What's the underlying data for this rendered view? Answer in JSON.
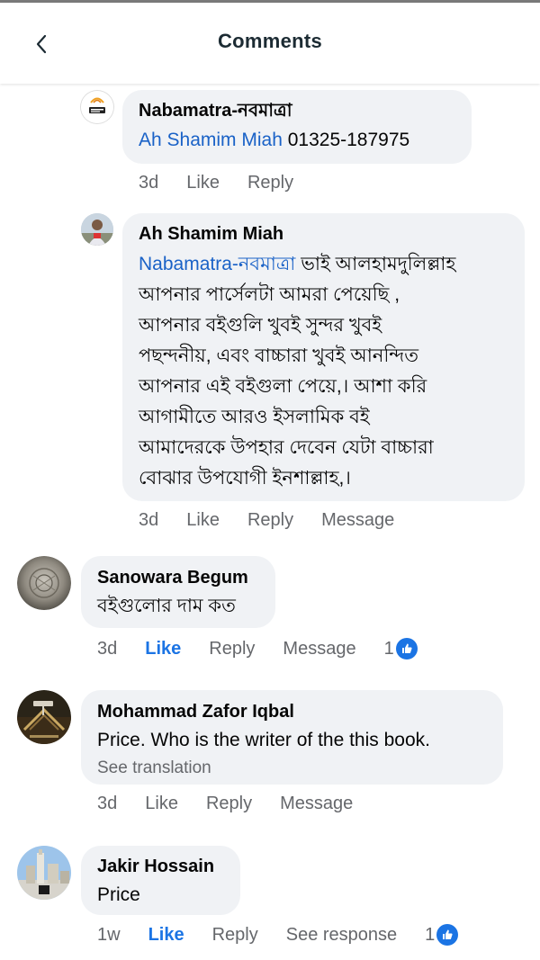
{
  "header": {
    "title": "Comments",
    "back_icon": "chevron-left-icon"
  },
  "colors": {
    "mention": "#1a62c7",
    "like_active": "#1b74e4",
    "bubble_bg": "#f0f2f5",
    "meta_text": "#65676b"
  },
  "comments": [
    {
      "name": "Nabamatra-নবমাত্রা",
      "mention": "Ah Shamim Miah",
      "text": " 01325-187975",
      "time": "3d",
      "like": "Like",
      "reply": "Reply"
    },
    {
      "name": "Ah Shamim Miah",
      "mention": "Nabamatra-নবমাত্রা",
      "lines": [
        " ভাই আলহামদুলিল্লাহ",
        "আপনার পার্সেলটা আমরা পেয়েছি ,",
        "আপনার বইগুলি খুবই সুন্দর খুবই",
        "পছন্দনীয়, এবং বাচ্চারা খুবই আনন্দিত",
        "আপনার এই বইগুলা পেয়ে,। আশা করি",
        "আগামীতে আরও ইসলামিক বই",
        "আমাদেরকে উপহার দেবেন যেটা বাচ্চারা",
        "বোঝার উপযোগী  ইনশাল্লাহ,।"
      ],
      "time": "3d",
      "like": "Like",
      "reply": "Reply",
      "message": "Message"
    },
    {
      "name": "Sanowara Begum",
      "text": "বইগুলোর দাম কত",
      "time": "3d",
      "like": "Like",
      "reply": "Reply",
      "message": "Message",
      "reactions": "1"
    },
    {
      "name": "Mohammad Zafor Iqbal",
      "text": "Price. Who is the writer of the this book.",
      "see_translation": "See translation",
      "time": "3d",
      "like": "Like",
      "reply": "Reply",
      "message": "Message"
    },
    {
      "name": "Jakir Hossain",
      "text": "Price",
      "time": "1w",
      "like": "Like",
      "reply": "Reply",
      "see_response": "See response",
      "reactions": "1"
    }
  ]
}
